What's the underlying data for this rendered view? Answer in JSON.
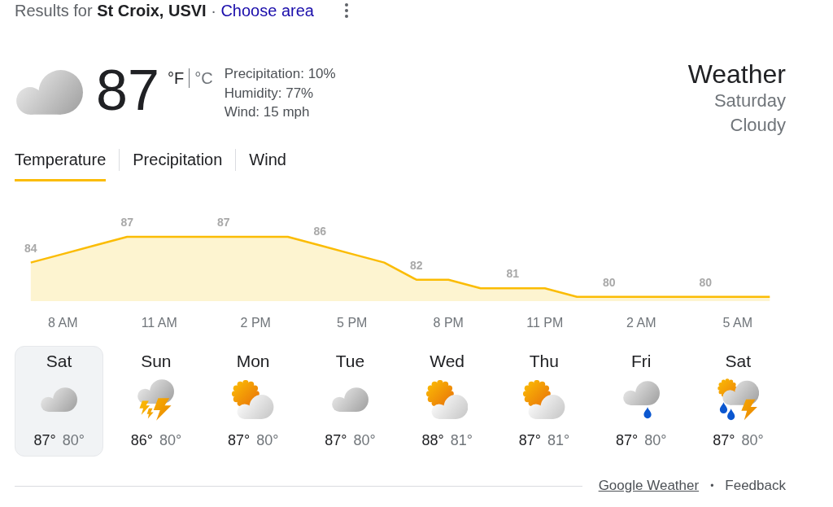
{
  "header": {
    "results": "Results for **St Croix, USVI** ·",
    "link": "Choose area"
  },
  "current": {
    "kind": "cloudy",
    "temperature": "87",
    "units": [
      {
        "label": "°F",
        "selected": true
      },
      {
        "label": "°C",
        "selected": false
      }
    ],
    "details": [
      "Precipitation: 10%",
      "Humidity: 77%",
      "Wind: 15 mph"
    ]
  },
  "summary": {
    "title": "Weather",
    "day": "Saturday",
    "condition": "Cloudy"
  },
  "tabs": [
    {
      "label": "Temperature",
      "selected": true
    },
    {
      "label": "Precipitation",
      "selected": false
    },
    {
      "label": "Wind",
      "selected": false
    }
  ],
  "hourly": {
    "chart_data": {
      "type": "area",
      "categories": [
        null,
        "8 AM",
        null,
        null,
        "11 AM",
        null,
        null,
        "2 PM",
        null,
        null,
        "5 PM",
        null,
        null,
        "8 PM",
        null,
        null,
        "11 PM",
        null,
        null,
        "2 AM",
        null,
        null,
        "5 AM",
        null
      ],
      "values": [
        84,
        85,
        86,
        87,
        87,
        87,
        87,
        87,
        87,
        86,
        85,
        84,
        82,
        82,
        81,
        81,
        81,
        80,
        80,
        80,
        80,
        80,
        80,
        80
      ],
      "value_labels": [
        "84",
        null,
        null,
        "87",
        null,
        null,
        "87",
        null,
        null,
        "86",
        null,
        null,
        "82",
        null,
        null,
        "81",
        null,
        null,
        "80",
        null,
        null,
        "80",
        null,
        null
      ]
    }
  },
  "days": [
    {
      "day": "Sat",
      "kind": "cloudy",
      "high": "87°",
      "low": "80°",
      "selected": true
    },
    {
      "day": "Sun",
      "kind": "thunderstorm",
      "high": "86°",
      "low": "80°",
      "selected": false
    },
    {
      "day": "Mon",
      "kind": "partly-cloudy",
      "high": "87°",
      "low": "80°",
      "selected": false
    },
    {
      "day": "Tue",
      "kind": "cloudy",
      "high": "87°",
      "low": "80°",
      "selected": false
    },
    {
      "day": "Wed",
      "kind": "partly-cloudy",
      "high": "88°",
      "low": "81°",
      "selected": false
    },
    {
      "day": "Thu",
      "kind": "partly-cloudy",
      "high": "87°",
      "low": "81°",
      "selected": false
    },
    {
      "day": "Fri",
      "kind": "rain",
      "high": "87°",
      "low": "80°",
      "selected": false
    },
    {
      "day": "Sat",
      "kind": "scattered-storms",
      "high": "87°",
      "low": "80°",
      "selected": false
    }
  ],
  "footer": {
    "source_link": "Google Weather",
    "separator": "•",
    "feedback": "Feedback"
  }
}
